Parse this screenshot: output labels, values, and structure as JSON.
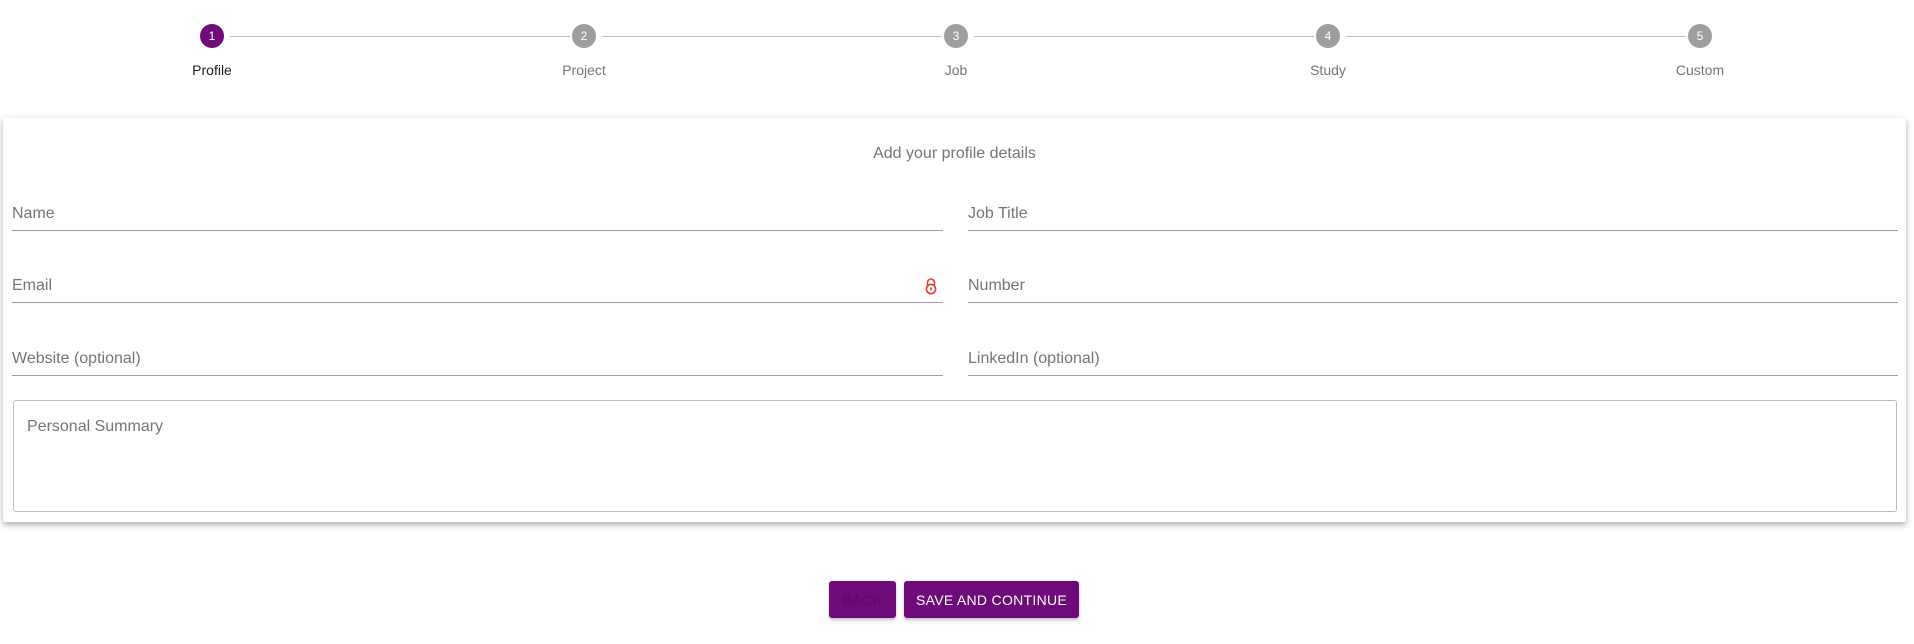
{
  "stepper": {
    "steps": [
      {
        "number": "1",
        "label": "Profile"
      },
      {
        "number": "2",
        "label": "Project"
      },
      {
        "number": "3",
        "label": "Job"
      },
      {
        "number": "4",
        "label": "Study"
      },
      {
        "number": "5",
        "label": "Custom"
      }
    ],
    "active_step": 1
  },
  "form": {
    "title": "Add your profile details",
    "fields": {
      "name": {
        "placeholder": "Name",
        "value": ""
      },
      "job_title": {
        "placeholder": "Job Title",
        "value": ""
      },
      "email": {
        "placeholder": "Email",
        "value": "",
        "icon": "lock-icon"
      },
      "number": {
        "placeholder": "Number",
        "value": ""
      },
      "website": {
        "placeholder": "Website (optional)",
        "value": ""
      },
      "linkedin": {
        "placeholder": "LinkedIn (optional)",
        "value": ""
      },
      "summary": {
        "placeholder": "Personal Summary",
        "value": ""
      }
    }
  },
  "actions": {
    "back_label": "Back",
    "save_label": "Save and continue"
  },
  "colors": {
    "accent": "#6f0a7a",
    "inactive_step": "#9e9e9e",
    "lock_icon": "#e53935"
  }
}
